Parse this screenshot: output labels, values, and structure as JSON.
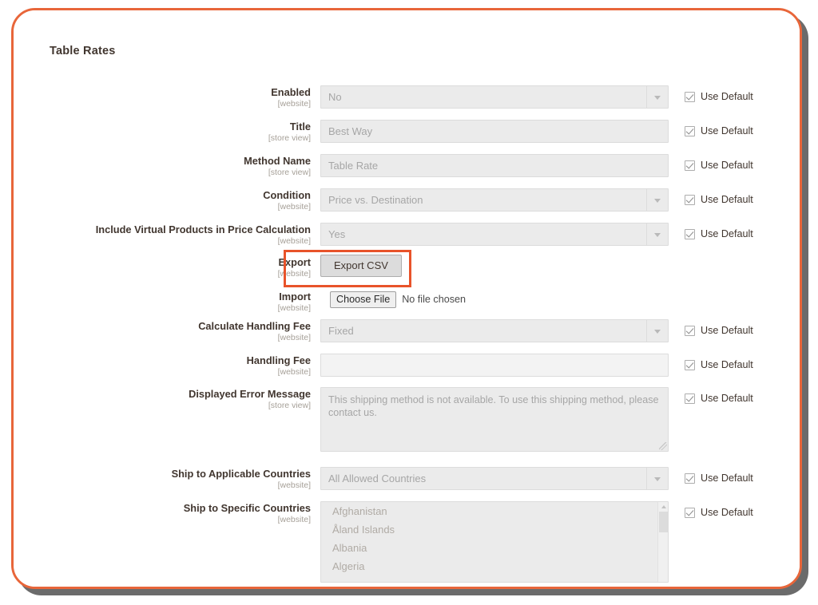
{
  "page": {
    "section_title": "Table Rates",
    "use_default_label": "Use Default",
    "accent_frame_color": "#e8663a",
    "highlight_color": "#e8532a"
  },
  "scopes": {
    "website": "[website]",
    "store_view": "[store view]"
  },
  "fields": {
    "enabled": {
      "label": "Enabled",
      "scope": "[website]",
      "type": "select",
      "value": "No",
      "use_default": true
    },
    "title": {
      "label": "Title",
      "scope": "[store view]",
      "type": "text",
      "value": "Best Way",
      "use_default": true
    },
    "method_name": {
      "label": "Method Name",
      "scope": "[store view]",
      "type": "text",
      "value": "Table Rate",
      "use_default": true
    },
    "condition": {
      "label": "Condition",
      "scope": "[website]",
      "type": "select",
      "value": "Price vs. Destination",
      "use_default": true
    },
    "include_virtual": {
      "label": "Include Virtual Products in Price Calculation",
      "scope": "[website]",
      "type": "select",
      "value": "Yes",
      "use_default": true
    },
    "export": {
      "label": "Export",
      "scope": "[website]",
      "type": "button",
      "button_label": "Export CSV",
      "highlighted": true
    },
    "import": {
      "label": "Import",
      "scope": "[website]",
      "type": "file",
      "button_label": "Choose File",
      "status": "No file chosen"
    },
    "calculate_handling_fee": {
      "label": "Calculate Handling Fee",
      "scope": "[website]",
      "type": "select",
      "value": "Fixed",
      "use_default": true
    },
    "handling_fee": {
      "label": "Handling Fee",
      "scope": "[website]",
      "type": "text",
      "value": "",
      "use_default": true
    },
    "displayed_error_message": {
      "label": "Displayed Error Message",
      "scope": "[store view]",
      "type": "textarea",
      "value": "This shipping method is not available. To use this shipping method, please contact us.",
      "use_default": true
    },
    "ship_applicable_countries": {
      "label": "Ship to Applicable Countries",
      "scope": "[website]",
      "type": "select",
      "value": "All Allowed Countries",
      "use_default": true
    },
    "ship_specific_countries": {
      "label": "Ship to Specific Countries",
      "scope": "[website]",
      "type": "multiselect",
      "options": [
        "Afghanistan",
        "Åland Islands",
        "Albania",
        "Algeria"
      ],
      "use_default": true
    }
  }
}
